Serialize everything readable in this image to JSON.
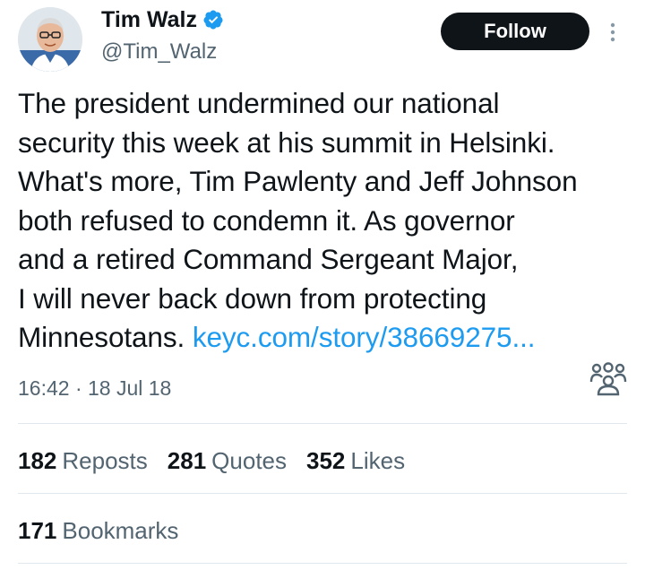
{
  "author": {
    "display_name": "Tim Walz",
    "handle": "@Tim_Walz",
    "verified_icon": "verified-badge-icon",
    "avatar_icon": "avatar"
  },
  "follow_button": {
    "label": "Follow"
  },
  "tweet": {
    "text_lines": [
      "The president undermined our national",
      "security this week at his summit in Helsinki.",
      "What's more, Tim Pawlenty and Jeff Johnson",
      "both refused to condemn it. As governor",
      "and a retired Command Sergeant Major,",
      "I will never back down from protecting",
      "Minnesotans."
    ],
    "link": "keyc.com/story/38669275...",
    "timestamp": "16:42 · 18 Jul 18"
  },
  "engagement": {
    "reposts": {
      "count": "182",
      "label": "Reposts"
    },
    "quotes": {
      "count": "281",
      "label": "Quotes"
    },
    "likes": {
      "count": "352",
      "label": "Likes"
    },
    "bookmarks": {
      "count": "171",
      "label": "Bookmarks"
    }
  },
  "colors": {
    "text": "#0f1419",
    "secondary": "#536471",
    "link": "#1d9bf0",
    "verified": "#1d9bf0",
    "button_bg": "#0f1419"
  }
}
